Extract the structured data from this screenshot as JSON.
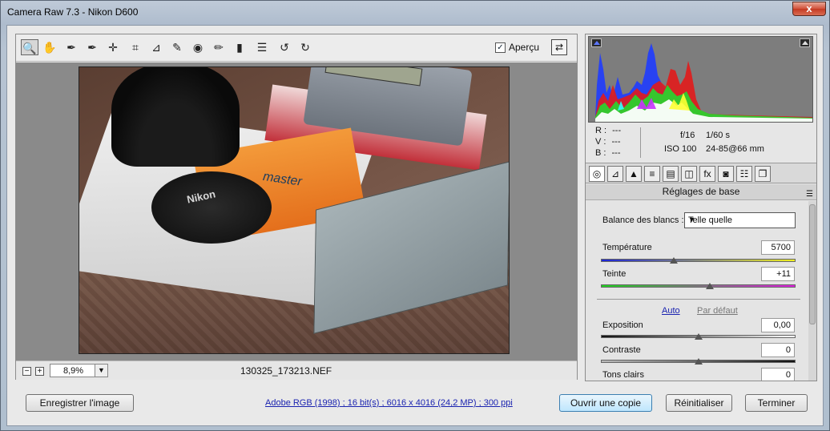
{
  "window": {
    "title": "Camera Raw 7.3  -  Nikon D600",
    "close_label": "x"
  },
  "toolbar": {
    "tools": [
      {
        "name": "zoom-tool",
        "glyph": "🔍"
      },
      {
        "name": "hand-tool",
        "glyph": "✋"
      },
      {
        "name": "white-balance-tool",
        "glyph": "✒"
      },
      {
        "name": "color-sampler-tool",
        "glyph": "✒"
      },
      {
        "name": "target-adjustment-tool",
        "glyph": "✛"
      },
      {
        "name": "crop-tool",
        "glyph": "⌗"
      },
      {
        "name": "straighten-tool",
        "glyph": "⊿"
      },
      {
        "name": "spot-removal-tool",
        "glyph": "✎"
      },
      {
        "name": "red-eye-tool",
        "glyph": "◉"
      },
      {
        "name": "adjustment-brush-tool",
        "glyph": "✏"
      },
      {
        "name": "graduated-filter-tool",
        "glyph": "▮"
      },
      {
        "name": "preferences-tool",
        "glyph": "☰"
      },
      {
        "name": "rotate-left-tool",
        "glyph": "↺"
      },
      {
        "name": "rotate-right-tool",
        "glyph": "↻"
      }
    ],
    "preview_label": "Aperçu",
    "preview_checked": "✓",
    "fullscreen_glyph": "⇄"
  },
  "photo": {
    "orange_text": "master",
    "cap_text": "Nikon"
  },
  "status": {
    "zoom_value": "8,9%",
    "zoom_minus": "−",
    "zoom_plus": "+",
    "zoom_arrow": "▼",
    "filename": "130325_173213.NEF"
  },
  "readout": {
    "r_label": "R :",
    "r_value": "---",
    "v_label": "V :",
    "v_value": "---",
    "b_label": "B :",
    "b_value": "---",
    "aperture": "f/16",
    "shutter": "1/60 s",
    "iso": "ISO 100",
    "lens": "24-85@66 mm"
  },
  "tabs": [
    "◎",
    "⊿",
    "▲",
    "≡",
    "▤",
    "◫",
    "fx",
    "◙",
    "☷",
    "❐"
  ],
  "panel": {
    "section_title": "Réglages de base",
    "menu_glyph": "☰",
    "wb_label": "Balance des blancs :",
    "wb_value": "Telle quelle",
    "wb_arrow": "▼",
    "temperature_label": "Température",
    "temperature_value": "5700",
    "tint_label": "Teinte",
    "tint_value": "+11",
    "auto_label": "Auto",
    "default_label": "Par défaut",
    "exposure_label": "Exposition",
    "exposure_value": "0,00",
    "contrast_label": "Contraste",
    "contrast_value": "0",
    "highlights_label": "Tons clairs",
    "highlights_value": "0"
  },
  "footer": {
    "save_label": "Enregistrer l'image",
    "info_link": "Adobe RGB (1998) ; 16 bit(s) ; 6016 x 4016 (24,2 MP) ; 300 ppi",
    "open_copy_label": "Ouvrir une copie",
    "reset_label": "Réinitialiser",
    "done_label": "Terminer"
  },
  "colors": {
    "accent_link": "#1a23b0",
    "primary_button": "#bee6fd"
  }
}
